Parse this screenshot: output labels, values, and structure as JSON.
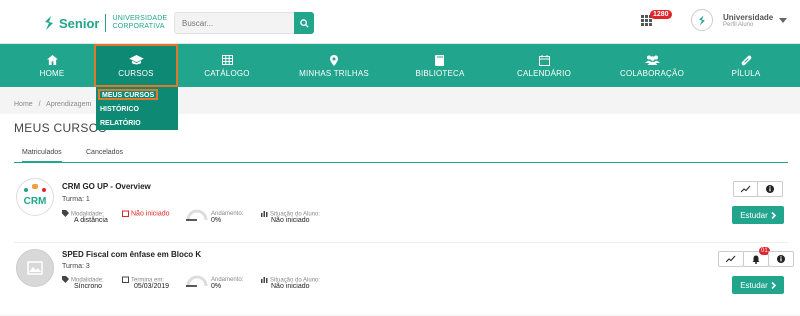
{
  "brand": {
    "name": "Senior",
    "subtitle_line1": "UNIVERSIDADE",
    "subtitle_line2": "CORPORATIVA"
  },
  "search": {
    "placeholder": "Buscar..."
  },
  "notifications": {
    "count": "1280"
  },
  "user": {
    "name": "Universidade",
    "profile": "Perfil Aluno"
  },
  "nav": {
    "items": [
      {
        "label": "HOME",
        "icon": "home-icon"
      },
      {
        "label": "CURSOS",
        "icon": "graduation-cap-icon"
      },
      {
        "label": "CATÁLOGO",
        "icon": "table-icon"
      },
      {
        "label": "MINHAS TRILHAS",
        "icon": "map-marker-icon"
      },
      {
        "label": "BIBLIOTECA",
        "icon": "book-icon"
      },
      {
        "label": "CALENDÁRIO",
        "icon": "calendar-icon"
      },
      {
        "label": "COLABORAÇÃO",
        "icon": "users-icon"
      },
      {
        "label": "PÍLULA",
        "icon": "pill-icon"
      }
    ],
    "dropdown": [
      "MEUS CURSOS",
      "HISTÓRICO",
      "RELATÓRIO"
    ]
  },
  "breadcrumb": {
    "home": "Home",
    "sep": "/",
    "current": "Aprendizagem"
  },
  "page": {
    "title": "MEUS CURSOS"
  },
  "tabs": [
    "Matriculados",
    "Cancelados"
  ],
  "courses": [
    {
      "title": "CRM GO UP - Overview",
      "turma": "Turma: 1",
      "modalidade_label": "Modalidade:",
      "modalidade": "A distância",
      "status": "Não iniciado",
      "andamento_label": "Andamento:",
      "andamento": "0%",
      "situacao_label": "Situação do Aluno:",
      "situacao": "Não iniciado",
      "study_label": "Estudar",
      "logo_text": "CRM"
    },
    {
      "title": "SPED Fiscal com ênfase em Bloco K",
      "turma": "Turma: 3",
      "modalidade_label": "Modalidade:",
      "modalidade": "Síncrono",
      "termina_label": "Termina em:",
      "termina": "05/03/2019",
      "andamento_label": "Andamento:",
      "andamento": "0%",
      "situacao_label": "Situação do Aluno:",
      "situacao": "Não iniciado",
      "study_label": "Estudar",
      "bell_badge": "01"
    }
  ],
  "colors": {
    "primary": "#21a58c",
    "primary_dark": "#0e8a74",
    "highlight": "#e0782c",
    "alert": "#e0262b"
  }
}
